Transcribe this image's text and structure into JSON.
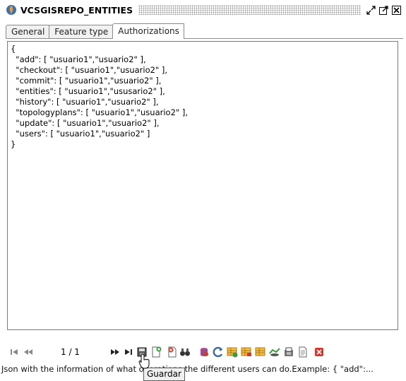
{
  "window": {
    "title": "VCSGISREPO_ENTITIES"
  },
  "tabs": [
    {
      "label": "General",
      "active": false
    },
    {
      "label": "Feature type",
      "active": false
    },
    {
      "label": "Authorizations",
      "active": true
    }
  ],
  "editor": {
    "lines": [
      "{",
      "  \"add\": [ \"usuario1\",\"usuario2\" ],",
      "  \"checkout\": [ \"usuario1\",\"usuario2\" ],",
      "  \"commit\": [ \"usuario1\",\"usuario2\" ],",
      "  \"entities\": [ \"usuario1\",\"ususario2\" ],",
      "  \"history\": [ \"usuario1\",\"usuario2\" ],",
      "  \"topologyplans\": [ \"usuario1\",\"usuario2\" ],",
      "  \"update\": [ \"usuario1\",\"usuario2\" ],",
      "  \"users\": [ \"usuario1\",\"usuario2\" ]",
      "}"
    ]
  },
  "pager": {
    "text": "1 / 1"
  },
  "status": {
    "text": "Json with the information of what operations the different users can do.Example: {  \"add\":..."
  },
  "tooltip": {
    "text": "Guardar"
  },
  "colors": {
    "accent_orange": "#f0a020",
    "icon_blue": "#3a6ea5",
    "icon_red": "#d9342b",
    "icon_green": "#3a9a3a"
  }
}
